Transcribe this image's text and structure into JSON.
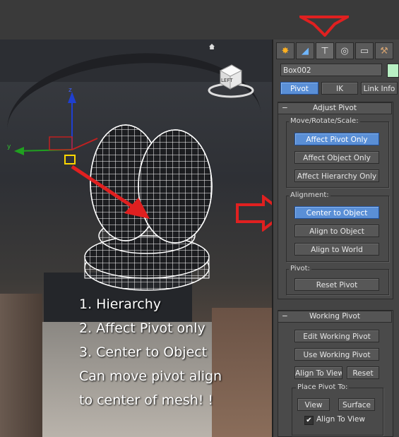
{
  "panel": {
    "object_name": "Box002",
    "tabs": [
      "Pivot",
      "IK",
      "Link Info"
    ],
    "tab_icons": [
      "create-tab-icon",
      "modify-tab-icon",
      "hierarchy-tab-icon",
      "motion-tab-icon",
      "display-tab-icon",
      "utilities-tab-icon"
    ],
    "adjust_pivot": {
      "title": "Adjust Pivot",
      "move_group_label": "Move/Rotate/Scale:",
      "affect_pivot_only": "Affect Pivot Only",
      "affect_object_only": "Affect Object Only",
      "affect_hierarchy_only": "Affect Hierarchy Only",
      "alignment_label": "Alignment:",
      "center_to_object": "Center to Object",
      "align_to_object": "Align to Object",
      "align_to_world": "Align to World",
      "pivot_label": "Pivot:",
      "reset_pivot": "Reset Pivot"
    },
    "working_pivot": {
      "title": "Working Pivot",
      "edit_working_pivot": "Edit Working Pivot",
      "use_working_pivot": "Use Working Pivot",
      "align_to_view": "Align To View",
      "reset": "Reset",
      "place_pivot_label": "Place Pivot To:",
      "view": "View",
      "surface": "Surface",
      "align_to_view_checkbox": "Align To View",
      "align_to_view_checked": true
    },
    "rollout_minus": "−"
  },
  "viewport": {
    "viewcube_label": "LEFT"
  },
  "annotation": {
    "line1": "1. Hierarchy",
    "line2": "2. Affect Pivot only",
    "line3": "3. Center to Object",
    "line4": "Can move pivot align",
    "line5": "to center of mesh! !"
  },
  "colors": {
    "accent_button": "#5a8fd6",
    "arrow": "#e02020",
    "object_color_swatch": "#b9f0c4"
  }
}
